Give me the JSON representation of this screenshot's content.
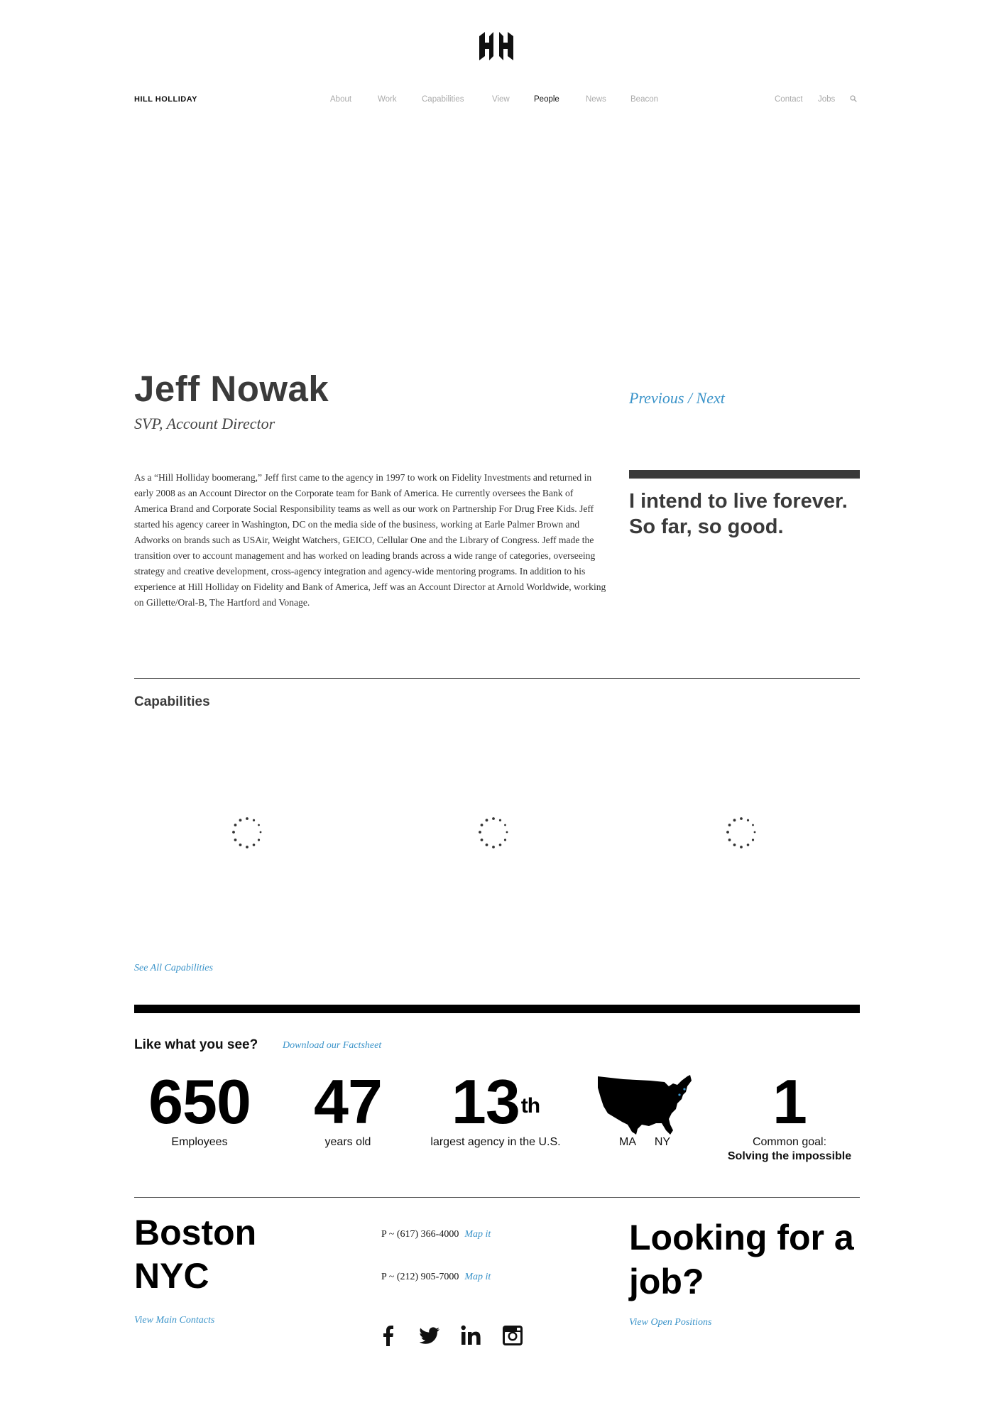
{
  "header": {
    "logo_mark": "HH",
    "brand": "HILL HOLLIDAY",
    "nav": [
      "About",
      "Work",
      "Capabilities",
      "View",
      "People",
      "News",
      "Beacon"
    ],
    "active_nav": "People",
    "utility": [
      "Contact",
      "Jobs"
    ],
    "search_icon": "search-icon"
  },
  "profile": {
    "name": "Jeff Nowak",
    "title": "SVP, Account Director",
    "previous": "Previous",
    "separator": "/",
    "next": "Next",
    "bio": "As a “Hill Holliday boomerang,” Jeff first came to the agency in 1997 to work on Fidelity Investments and returned in early 2008 as an Account Director on the Corporate team for Bank of America. He currently oversees the Bank of America Brand and Corporate Social Responsibility teams as well as our work on Partnership For Drug Free Kids. Jeff started his agency career in Washington, DC on the media side of the business, working at Earle Palmer Brown and Adworks on brands such as USAir, Weight Watchers, GEICO, Cellular One and the Library of Congress. Jeff made the transition over to account management and has worked on leading brands across a wide range of categories, overseeing strategy and creative development, cross-agency integration and agency-wide mentoring programs. In addition to his experience at Hill Holliday on Fidelity and Bank of America, Jeff was an Account Director at Arnold Worldwide, working on Gillette/Oral-B, The Hartford and Vonage.",
    "quote": "I intend to live forever. So far, so good."
  },
  "capabilities": {
    "title": "Capabilities",
    "see_all": "See All Capabilities"
  },
  "stats": {
    "headline": "Like what you see?",
    "factsheet": "Download our Factsheet",
    "employees": {
      "value": "650",
      "label": "Employees"
    },
    "age": {
      "value": "47",
      "label": "years old"
    },
    "rank": {
      "value": "13",
      "suffix": "th",
      "label": "largest agency in the U.S."
    },
    "locations": {
      "left": "MA",
      "right": "NY"
    },
    "goal": {
      "value": "1",
      "label": "Common goal:",
      "sublabel": "Solving the impossible"
    }
  },
  "footer": {
    "city1": "Boston",
    "city2": "NYC",
    "phone1": "P ~ (617) 366-4000",
    "phone2": "P ~ (212) 905-7000",
    "map_it": "Map it",
    "main_contacts": "View Main Contacts",
    "job_heading": "Looking for a job?",
    "positions": "View Open Positions",
    "social": [
      "facebook-icon",
      "twitter-icon",
      "linkedin-icon",
      "instagram-icon"
    ]
  },
  "colors": {
    "link": "#3a93c9",
    "heading": "#3a3a3a",
    "text": "#333333"
  }
}
